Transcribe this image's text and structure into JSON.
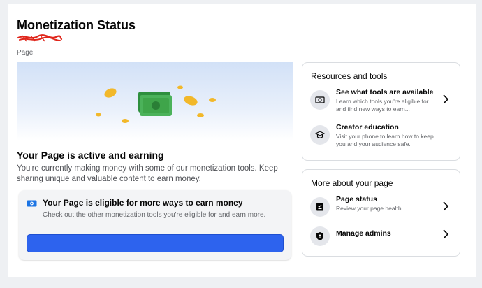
{
  "header": {
    "title": "Monetization Status",
    "subtitle": "Page"
  },
  "status": {
    "title": "Your Page is active and earning",
    "description": "You're currently making money with some of our monetization tools. Keep sharing unique and valuable content to earn money."
  },
  "eligible": {
    "title": "Your Page is eligible for more ways to earn money",
    "description": "Check out the other monetization tools you're eligible for and earn more.",
    "button_label": ""
  },
  "resources": {
    "heading": "Resources and tools",
    "items": [
      {
        "title": "See what tools are available",
        "description": "Learn which tools you're eligible for and find new ways to earn...",
        "icon": "money-icon"
      },
      {
        "title": "Creator education",
        "description": "Visit your phone to learn how to keep you and your audience safe.",
        "icon": "graduation-cap-icon"
      }
    ]
  },
  "more": {
    "heading": "More about your page",
    "items": [
      {
        "title": "Page status",
        "description": "Review your page health",
        "icon": "clipboard-check-icon"
      },
      {
        "title": "Manage admins",
        "description": "",
        "icon": "shield-icon"
      }
    ]
  },
  "colors": {
    "accent": "#2d63ee",
    "redaction": "#e0261b",
    "money_green": "#3fa54a",
    "coin_gold": "#f2b82a"
  }
}
